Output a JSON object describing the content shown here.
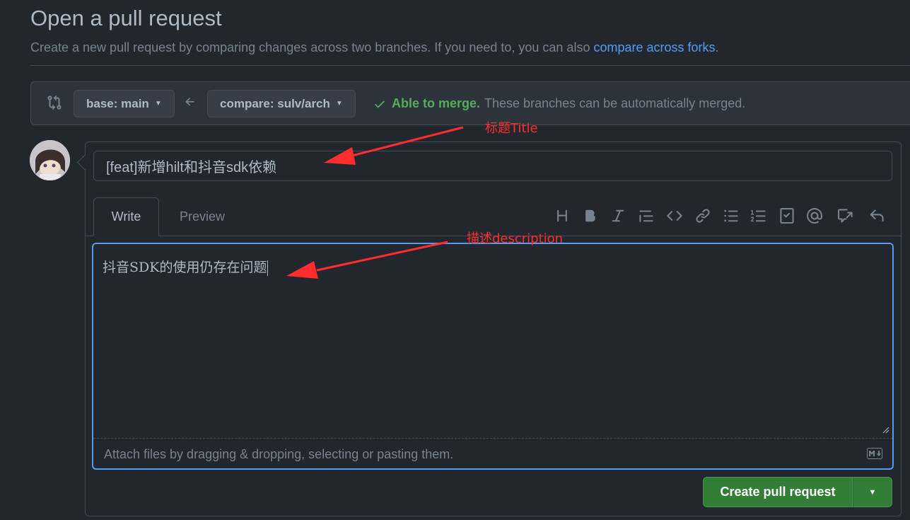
{
  "header": {
    "title": "Open a pull request",
    "subtitle_prefix": "Create a new pull request by comparing changes across two branches. If you need to, you can also ",
    "subtitle_link": "compare across forks",
    "subtitle_suffix": "."
  },
  "range": {
    "base_label": "base: main",
    "compare_label": "compare: sulv/arch",
    "status_strong": "Able to merge.",
    "status_text": "These branches can be automatically merged."
  },
  "form": {
    "title_value": "[feat]新增hilt和抖音sdk依赖",
    "tabs": [
      {
        "label": "Write",
        "active": true
      },
      {
        "label": "Preview",
        "active": false
      }
    ],
    "description_value": "抖音SDK的使用仍存在问题",
    "attach_text": "Attach files by dragging & dropping, selecting or pasting them.",
    "submit_label": "Create pull request"
  },
  "toolbar": {
    "icons": [
      "heading-icon",
      "bold-icon",
      "italic-icon",
      "quote-icon",
      "code-icon",
      "link-icon",
      "bulleted-list-icon",
      "numbered-list-icon",
      "task-list-icon",
      "mention-icon",
      "reference-icon",
      "reply-icon"
    ]
  },
  "annotations": {
    "title_label": "标题Title",
    "description_label": "描述description",
    "color": "#ff2d2d"
  },
  "colors": {
    "background": "#22272e",
    "accent": "#539bf5",
    "success": "#57ab5a",
    "button_green": "#347d39"
  }
}
